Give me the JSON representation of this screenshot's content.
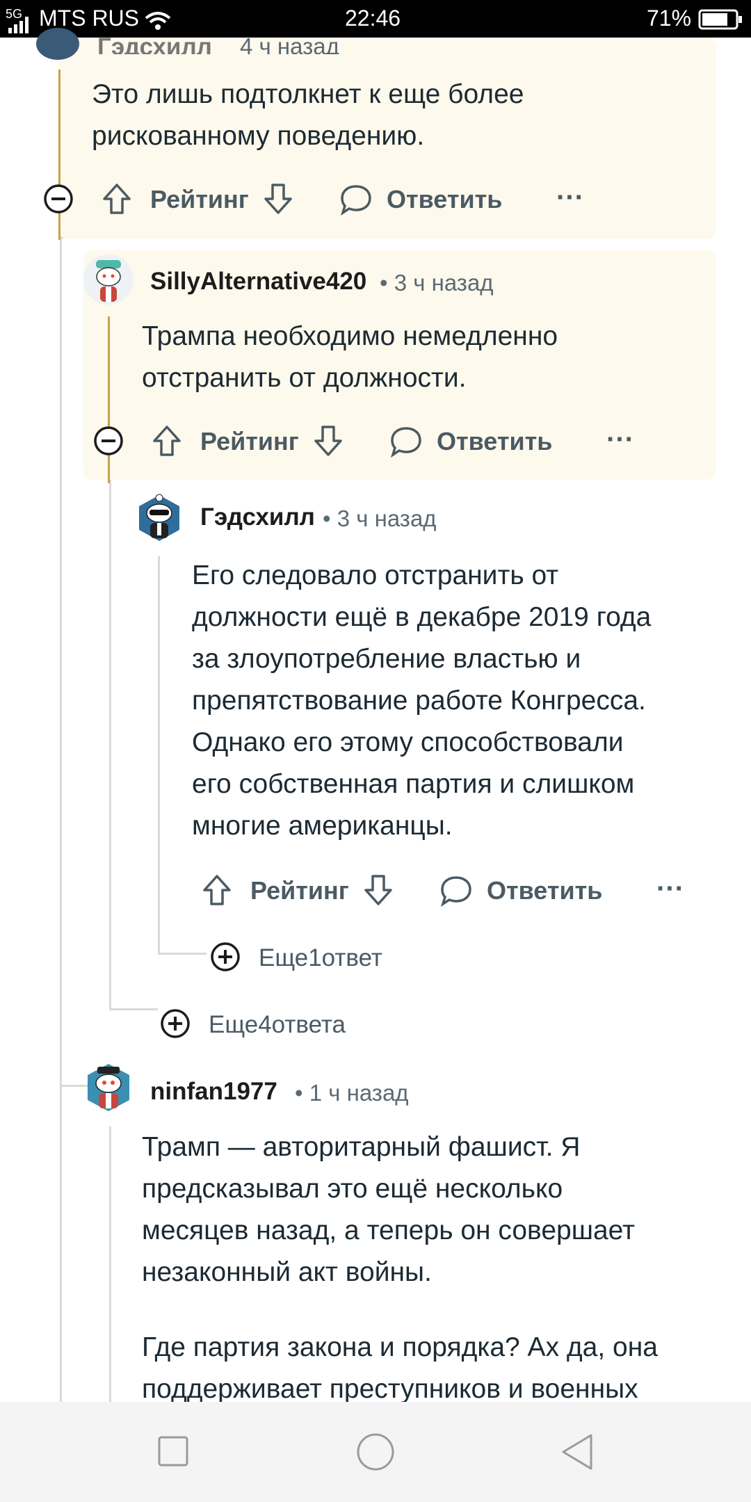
{
  "status_bar": {
    "signal": "5G",
    "carrier": "MTS RUS",
    "time": "22:46",
    "battery": "71%"
  },
  "comments": [
    {
      "author": "Гэдсхилл",
      "time": "4 ч назад",
      "text": "Это лишь подтолкнет к еще более рискованному поведению.",
      "text_lines": [
        "Это лишь подтолкнет к еще более",
        "рискованному поведению."
      ],
      "actions": {
        "rating": "Рейтинг",
        "reply": "Ответить",
        "more": "···"
      }
    },
    {
      "author": "SillyAlternative420",
      "time": "• 3 ч назад",
      "text_lines": [
        "Трампа необходимо немедленно",
        "отстранить от должности."
      ],
      "actions": {
        "rating": "Рейтинг",
        "reply": "Ответить",
        "more": "···"
      }
    },
    {
      "author": "Гэдсхилл",
      "time": "• 3 ч назад",
      "text_lines": [
        "Его следовало отстранить от",
        "должности ещё в декабре 2019 года",
        "за злоупотребление властью и",
        "препятствование работе Конгресса.",
        "Однако его этому способствовали",
        "его собственная партия и слишком",
        "многие американцы."
      ],
      "actions": {
        "rating": "Рейтинг",
        "reply": "Ответить",
        "more": "···"
      },
      "more_replies": "Еще1ответ"
    },
    {
      "more_replies": "Еще4ответа"
    },
    {
      "author": "ninfan1977",
      "time": "• 1 ч назад",
      "text_lines": [
        "Трамп — авторитарный фашист. Я",
        "предсказывал это ещё несколько",
        "месяцев назад, а теперь он совершает",
        "незаконный акт войны."
      ],
      "text_lines_2": [
        "Где партия закона и порядка? Ах да, она",
        "поддерживает преступников и военных"
      ]
    }
  ],
  "nav": {
    "square": "recent-apps",
    "circle": "home",
    "triangle": "back"
  },
  "colors": {
    "highlight_bg": "#fdf9ec",
    "thread_line": "#d9d9d9",
    "gold_line": "#c8a24a",
    "action_text": "#4b5a63"
  }
}
